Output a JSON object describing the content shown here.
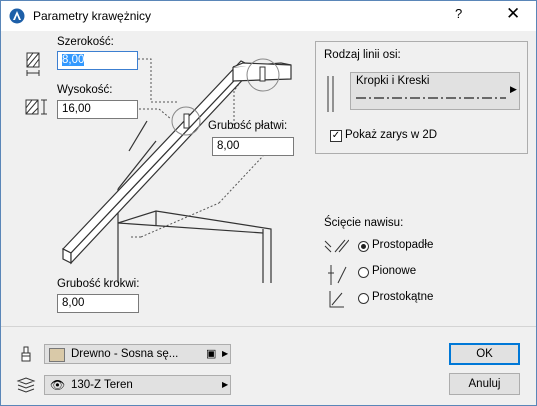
{
  "window": {
    "title": "Parametry krawężnicy",
    "help_label": "?",
    "close_label": "✕"
  },
  "left": {
    "width_label": "Szerokość:",
    "width_value": "8,00",
    "height_label": "Wysokość:",
    "height_value": "16,00",
    "purlin_label": "Grubość płatwi:",
    "purlin_value": "8,00",
    "rafter_label": "Grubość krokwi:",
    "rafter_value": "8,00"
  },
  "axis_panel": {
    "title": "Rodzaj linii osi:",
    "line_type": "Kropki i Kreski",
    "show_outline_label": "Pokaż zarys w 2D",
    "show_outline_checked": true
  },
  "eave_cut": {
    "title": "Ścięcie nawisu:",
    "options": [
      "Prostopadłe",
      "Pionowe",
      "Prostokątne"
    ],
    "selected": 0
  },
  "bottom": {
    "material": "Drewno - Sosna sę...",
    "layer": "130-Z Teren",
    "ok_label": "OK",
    "cancel_label": "Anuluj"
  }
}
